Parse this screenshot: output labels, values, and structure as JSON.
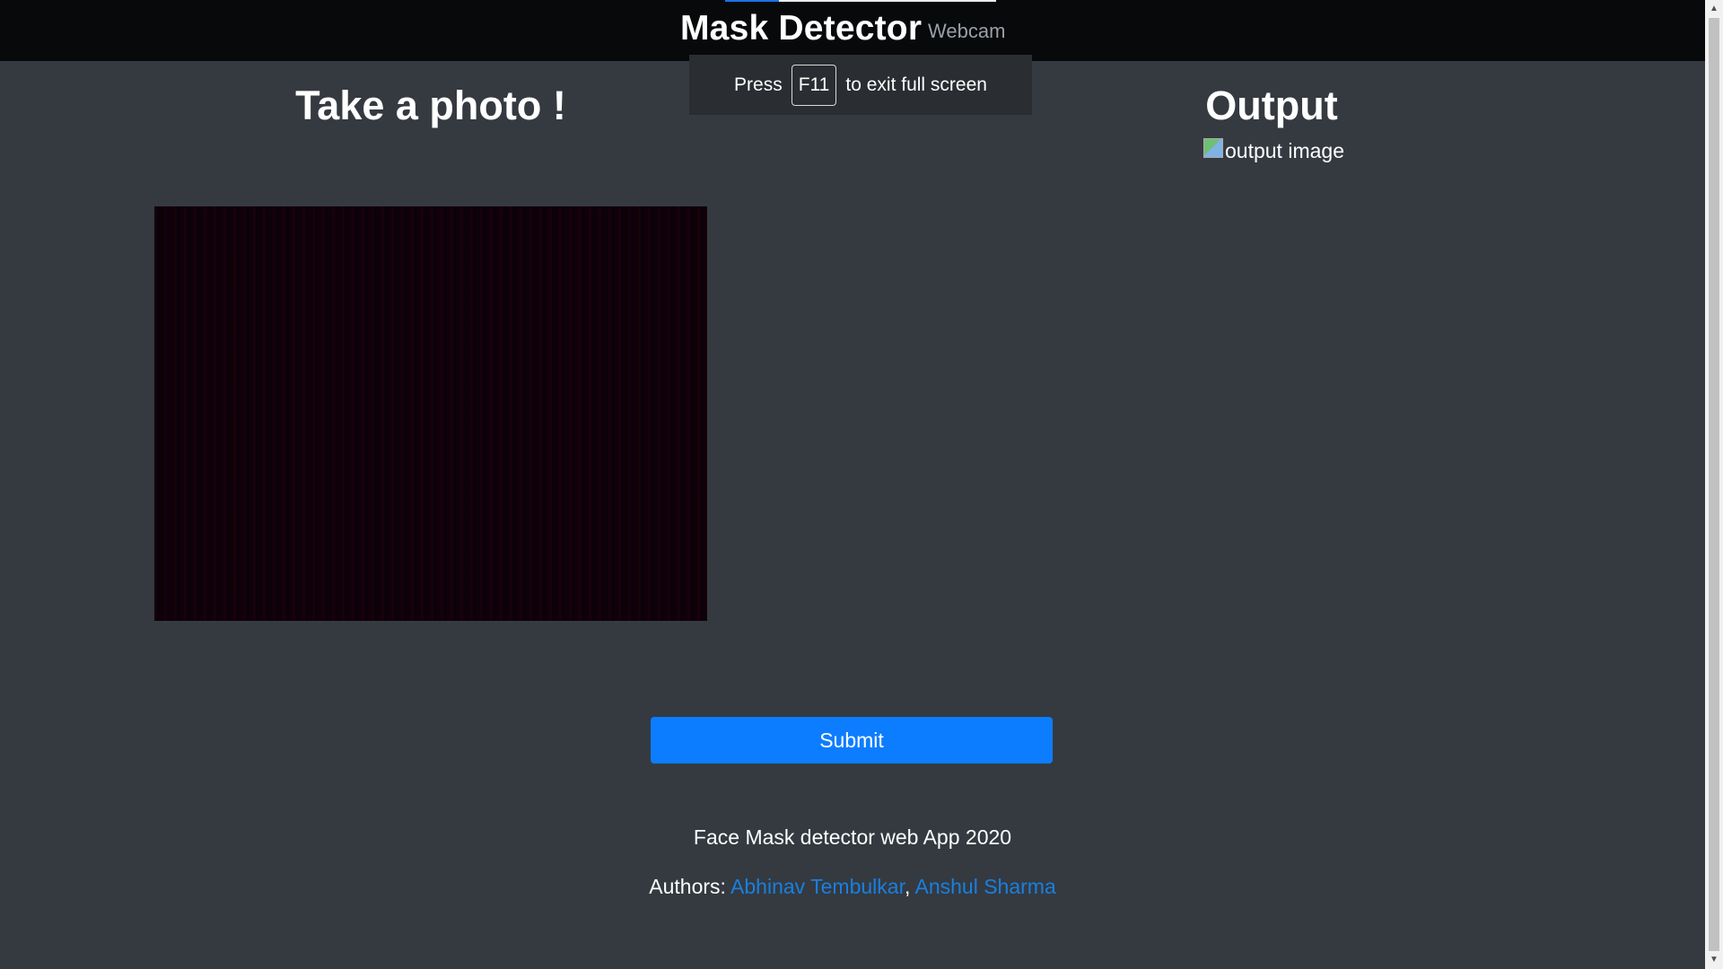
{
  "navbar": {
    "brand": "Mask Detector",
    "link": "Webcam"
  },
  "fullscreen_hint": {
    "prefix": "Press",
    "key": "F11",
    "suffix": "to exit full screen"
  },
  "left": {
    "heading": "Take a photo !"
  },
  "right": {
    "heading": "Output",
    "image_alt": "output image"
  },
  "submit_label": "Submit",
  "footer": {
    "line1": "Face Mask detector web App 2020",
    "authors_label": "Authors:",
    "author1": "Abhinav Tembulkar",
    "separator": ",",
    "author2": "Anshul Sharma"
  },
  "colors": {
    "background": "#343a40",
    "navbar": "#07090b",
    "button": "#0d7dff",
    "link": "#1a7fe0"
  },
  "icons": {
    "broken_image": "broken-image-icon",
    "scroll_up": "arrow-up-icon",
    "scroll_down": "arrow-down-icon"
  }
}
